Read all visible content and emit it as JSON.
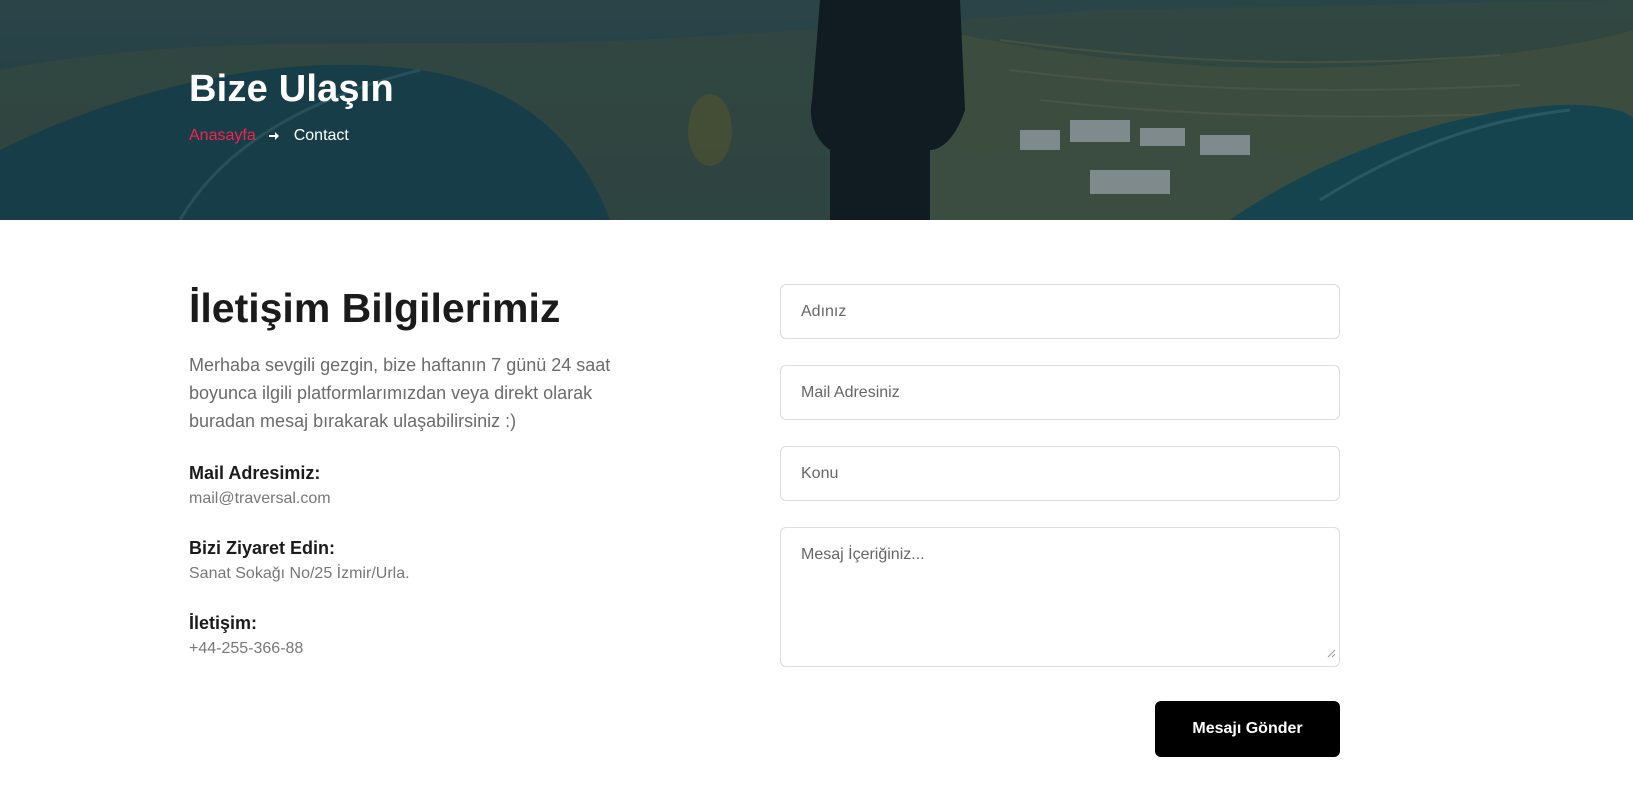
{
  "hero": {
    "title": "Bize Ulaşın",
    "breadcrumb": {
      "home": "Anasayfa",
      "separator_icon": "arrow-right-icon",
      "current": "Contact"
    }
  },
  "info": {
    "title": "İletişim Bilgilerimiz",
    "description": "Merhaba sevgili gezgin, bize haftanın 7 günü 24 saat boyunca ilgili platformlarımızdan veya direkt olarak buradan mesaj bırakarak ulaşabilirsiniz :)",
    "items": [
      {
        "label": "Mail Adresimiz:",
        "value": "mail@traversal.com"
      },
      {
        "label": "Bizi Ziyaret Edin:",
        "value": "Sanat Sokağı No/25 İzmir/Urla."
      },
      {
        "label": "İletişim:",
        "value": "+44-255-366-88"
      }
    ]
  },
  "form": {
    "name_placeholder": "Adınız",
    "email_placeholder": "Mail Adresiniz",
    "subject_placeholder": "Konu",
    "message_placeholder": "Mesaj İçeriğiniz...",
    "submit_label": "Mesajı Gönder"
  },
  "colors": {
    "accent": "#f5214f",
    "button": "#000000",
    "hero_overlay": "#1d3f4a"
  }
}
